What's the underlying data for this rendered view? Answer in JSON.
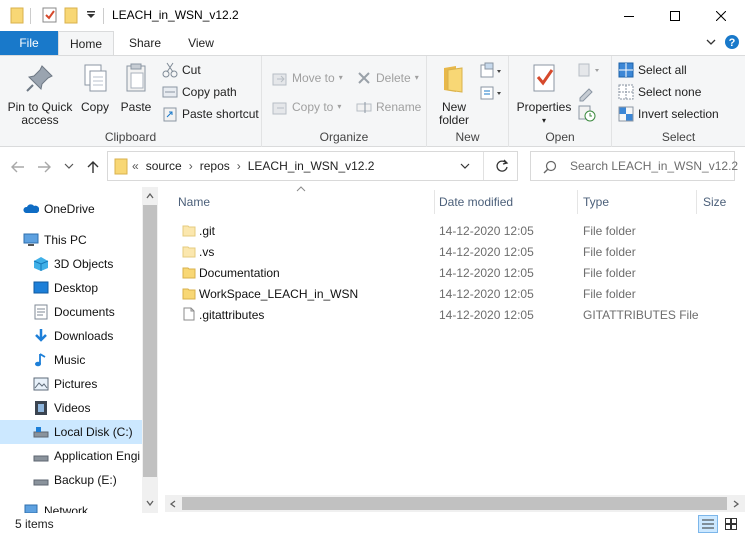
{
  "window": {
    "title": "LEACH_in_WSN_v12.2"
  },
  "tabs": [
    {
      "label": "File"
    },
    {
      "label": "Home"
    },
    {
      "label": "Share"
    },
    {
      "label": "View"
    }
  ],
  "ribbon": {
    "clipboard": {
      "group_label": "Clipboard",
      "pin_label_1": "Pin to Quick",
      "pin_label_2": "access",
      "copy": "Copy",
      "paste": "Paste",
      "cut": "Cut",
      "copy_path": "Copy path",
      "paste_shortcut": "Paste shortcut"
    },
    "organize": {
      "group_label": "Organize",
      "move_to": "Move to",
      "copy_to": "Copy to",
      "delete": "Delete",
      "rename": "Rename"
    },
    "new": {
      "group_label": "New",
      "new_folder_1": "New",
      "new_folder_2": "folder"
    },
    "open": {
      "group_label": "Open",
      "properties": "Properties"
    },
    "select": {
      "group_label": "Select",
      "select_all": "Select all",
      "select_none": "Select none",
      "invert_selection": "Invert selection"
    }
  },
  "address": {
    "overflow": "«",
    "crumbs": [
      "source",
      "repos",
      "LEACH_in_WSN_v12.2"
    ],
    "separator": "›"
  },
  "search": {
    "placeholder": "Search LEACH_in_WSN_v12.2"
  },
  "nav": [
    {
      "label": "OneDrive",
      "icon": "cloud-icon"
    },
    {
      "label": "This PC",
      "icon": "computer-icon"
    },
    {
      "label": "3D Objects",
      "icon": "cube-icon"
    },
    {
      "label": "Desktop",
      "icon": "desktop-icon"
    },
    {
      "label": "Documents",
      "icon": "documents-icon"
    },
    {
      "label": "Downloads",
      "icon": "download-arrow-icon"
    },
    {
      "label": "Music",
      "icon": "music-note-icon"
    },
    {
      "label": "Pictures",
      "icon": "pictures-icon"
    },
    {
      "label": "Videos",
      "icon": "film-icon"
    },
    {
      "label": "Local Disk (C:)",
      "icon": "drive-icon"
    },
    {
      "label": "Application Engi",
      "icon": "drive-icon"
    },
    {
      "label": "Backup (E:)",
      "icon": "drive-icon"
    },
    {
      "label": "Network",
      "icon": "network-icon"
    }
  ],
  "columns": {
    "name": "Name",
    "date": "Date modified",
    "type": "Type",
    "size": "Size"
  },
  "files": [
    {
      "name": ".git",
      "date": "14-12-2020 12:05",
      "type": "File folder",
      "kind": "folder-faded"
    },
    {
      "name": ".vs",
      "date": "14-12-2020 12:05",
      "type": "File folder",
      "kind": "folder-faded"
    },
    {
      "name": "Documentation",
      "date": "14-12-2020 12:05",
      "type": "File folder",
      "kind": "folder"
    },
    {
      "name": "WorkSpace_LEACH_in_WSN",
      "date": "14-12-2020 12:05",
      "type": "File folder",
      "kind": "folder"
    },
    {
      "name": ".gitattributes",
      "date": "14-12-2020 12:05",
      "type": "GITATTRIBUTES File",
      "kind": "file"
    }
  ],
  "status": {
    "count": "5 items"
  },
  "colors": {
    "accent": "#1979ca",
    "folder": "#f8d775",
    "selection": "#cce8ff"
  }
}
